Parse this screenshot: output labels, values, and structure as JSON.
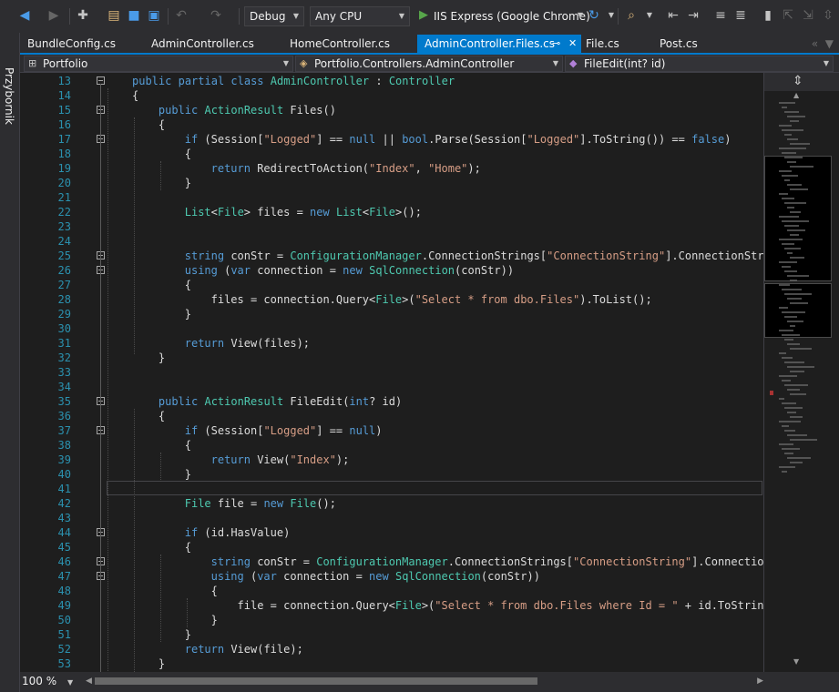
{
  "toolbar": {
    "configuration": "Debug",
    "platform": "Any CPU",
    "run_target": "IIS Express (Google Chrome)"
  },
  "toolbox": {
    "label": "Przybornik"
  },
  "tabs": [
    {
      "label": "BundleConfig.cs",
      "active": false
    },
    {
      "label": "AdminController.cs",
      "active": false
    },
    {
      "label": "HomeController.cs",
      "active": false
    },
    {
      "label": "AdminController.Files.cs",
      "active": true
    },
    {
      "label": "File.cs",
      "active": false
    },
    {
      "label": "Post.cs",
      "active": false
    }
  ],
  "nav": {
    "project": "Portfolio",
    "type": "Portfolio.Controllers.AdminController",
    "member": "FileEdit(int? id)"
  },
  "editor": {
    "zoom": "100 %",
    "lines": [
      {
        "n": "13",
        "c": "public partial class AdminController : Controller"
      },
      {
        "n": "14",
        "c": "{"
      },
      {
        "n": "15",
        "c": "public ActionResult Files()"
      },
      {
        "n": "16",
        "c": "{"
      },
      {
        "n": "17",
        "c": "if (Session[\"Logged\"] == null || bool.Parse(Session[\"Logged\"].ToString()) == false)"
      },
      {
        "n": "18",
        "c": "{"
      },
      {
        "n": "19",
        "c": "return RedirectToAction(\"Index\", \"Home\");"
      },
      {
        "n": "20",
        "c": "}"
      },
      {
        "n": "21",
        "c": ""
      },
      {
        "n": "22",
        "c": "List<File> files = new List<File>();"
      },
      {
        "n": "23",
        "c": ""
      },
      {
        "n": "24",
        "c": ""
      },
      {
        "n": "25",
        "c": "string conStr = ConfigurationManager.ConnectionStrings[\"ConnectionString\"].ConnectionString"
      },
      {
        "n": "26",
        "c": "using (var connection = new SqlConnection(conStr))"
      },
      {
        "n": "27",
        "c": "{"
      },
      {
        "n": "28",
        "c": "files = connection.Query<File>(\"Select * from dbo.Files\").ToList();"
      },
      {
        "n": "29",
        "c": "}"
      },
      {
        "n": "30",
        "c": ""
      },
      {
        "n": "31",
        "c": "return View(files);"
      },
      {
        "n": "32",
        "c": "}"
      },
      {
        "n": "33",
        "c": ""
      },
      {
        "n": "34",
        "c": ""
      },
      {
        "n": "35",
        "c": "public ActionResult FileEdit(int? id)"
      },
      {
        "n": "36",
        "c": "{"
      },
      {
        "n": "37",
        "c": "if (Session[\"Logged\"] == null)"
      },
      {
        "n": "38",
        "c": "{"
      },
      {
        "n": "39",
        "c": "return View(\"Index\");"
      },
      {
        "n": "40",
        "c": "}"
      },
      {
        "n": "41",
        "c": ""
      },
      {
        "n": "42",
        "c": "File file = new File();"
      },
      {
        "n": "43",
        "c": ""
      },
      {
        "n": "44",
        "c": "if (id.HasValue)"
      },
      {
        "n": "45",
        "c": "{"
      },
      {
        "n": "46",
        "c": "string conStr = ConfigurationManager.ConnectionStrings[\"ConnectionString\"].ConnectionSt"
      },
      {
        "n": "47",
        "c": "using (var connection = new SqlConnection(conStr))"
      },
      {
        "n": "48",
        "c": "{"
      },
      {
        "n": "49",
        "c": "file = connection.Query<File>(\"Select * from dbo.Files where Id = \" + id.ToString()"
      },
      {
        "n": "50",
        "c": "}"
      },
      {
        "n": "51",
        "c": "}"
      },
      {
        "n": "52",
        "c": "return View(file);"
      },
      {
        "n": "53",
        "c": "}"
      }
    ]
  },
  "colors": {
    "accent": "#007acc",
    "keyword": "#569cd6",
    "type": "#4ec9b0",
    "string": "#d69d85",
    "line_number": "#2b91af",
    "change_saved": "#57a64a",
    "change_unsaved": "#efc800"
  },
  "icons": [
    "back-icon",
    "forward-icon",
    "new-project-icon",
    "open-icon",
    "save-icon",
    "save-all-icon",
    "undo-icon",
    "redo-icon",
    "play-icon",
    "refresh-icon",
    "find-icon",
    "bookmark-icon",
    "comment-icon"
  ]
}
